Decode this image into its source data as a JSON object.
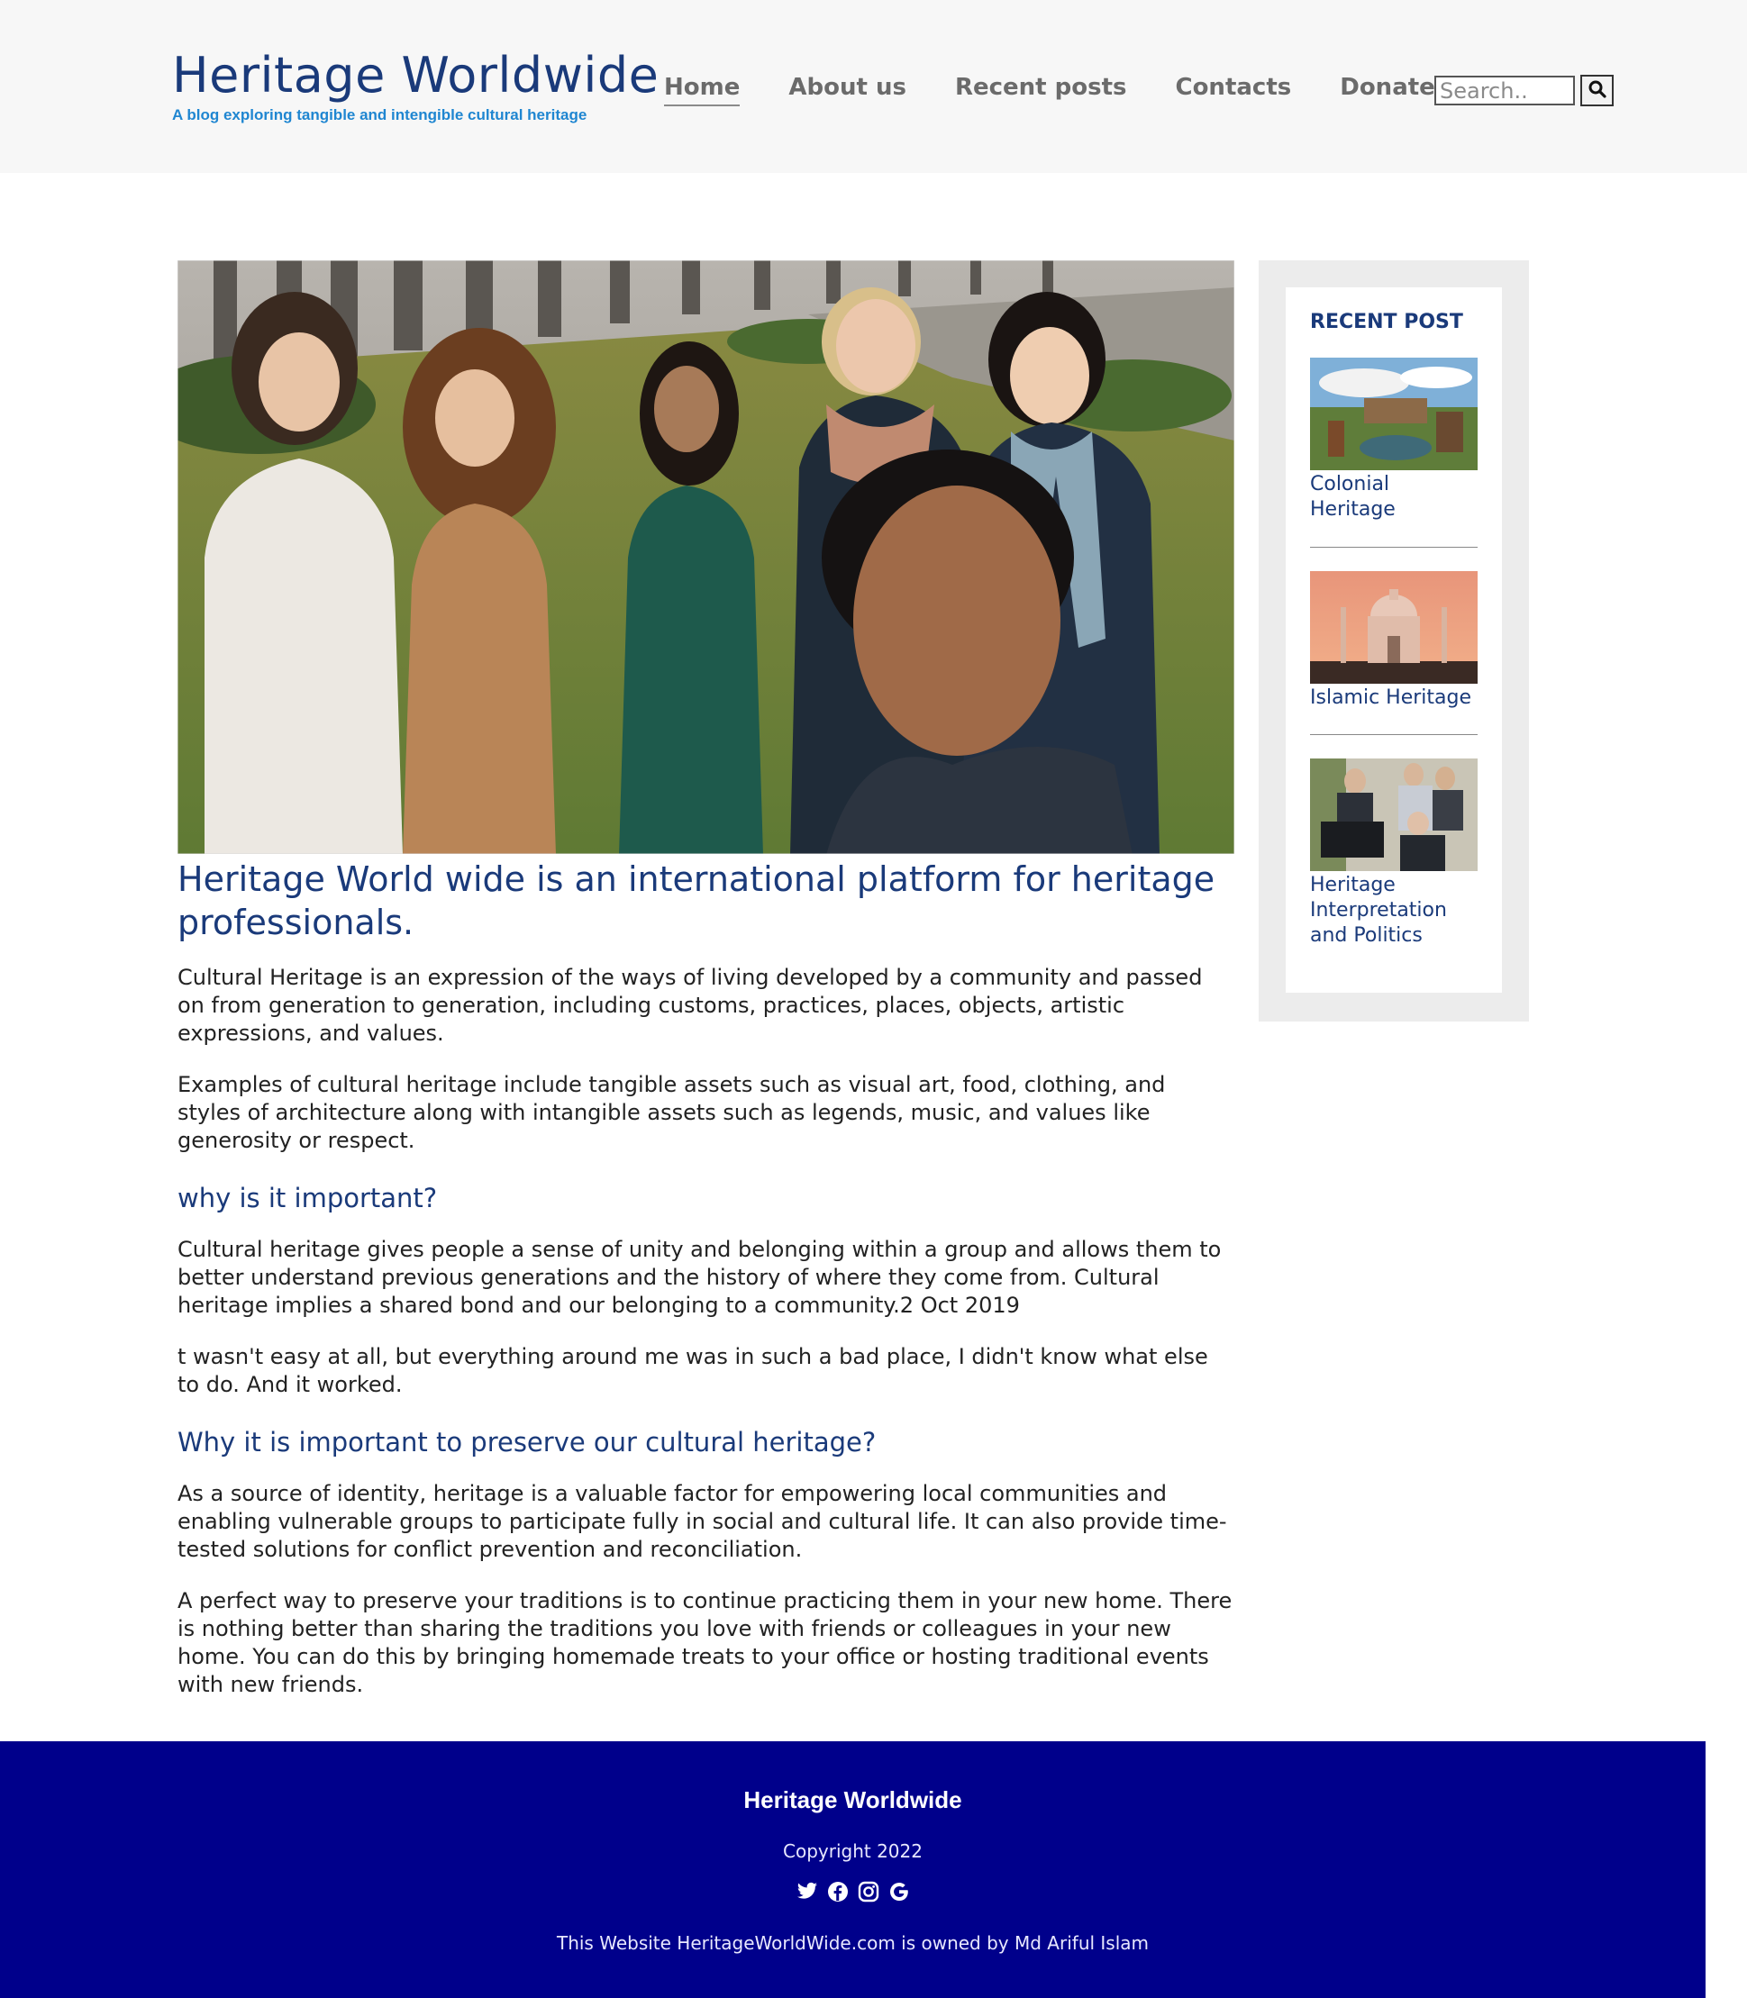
{
  "header": {
    "title": "Heritage Worldwide",
    "tagline": "A blog exploring tangible and intengible cultural heritage",
    "nav": [
      {
        "label": "Home"
      },
      {
        "label": "About us"
      },
      {
        "label": "Recent posts"
      },
      {
        "label": "Contacts"
      },
      {
        "label": "Donates"
      }
    ],
    "search": {
      "placeholder": "Search..",
      "button_icon": "search-icon"
    }
  },
  "main": {
    "headline": "Heritage World wide is an international platform for heritage professionals.",
    "paragraphs_intro": [
      "Cultural Heritage is an expression of the ways of living developed by a community and passed on from generation to generation, including customs, practices, places, objects, artistic expressions, and values.",
      "Examples of cultural heritage include tangible assets such as visual art, food, clothing, and styles of architecture along with intangible assets such as legends, music, and values like generosity or respect."
    ],
    "heading_important": "why is it important?",
    "paragraphs_important": [
      "Cultural heritage gives people a sense of unity and belonging within a group and allows them to better understand previous generations and the history of where they come from. Cultural heritage implies a shared bond and our belonging to a community.2 Oct 2019",
      "t wasn't easy at all, but everything around me was in such a bad place, I didn't know what else to do. And it worked."
    ],
    "heading_preserve": "Why it is important to preserve our cultural heritage?",
    "paragraphs_preserve": [
      "As a source of identity, heritage is a valuable factor for empowering local communities and enabling vulnerable groups to participate fully in social and cultural life. It can also provide time-tested solutions for conflict prevention and reconciliation.",
      "A perfect way to preserve your traditions is to continue practicing them in your new home. There is nothing better than sharing the traditions you love with friends or colleagues in your new home. You can do this by bringing homemade treats to your office or hosting traditional events with new friends."
    ]
  },
  "sidebar": {
    "title": "RECENT POST",
    "posts": [
      {
        "label": "Colonial Heritage"
      },
      {
        "label": "Islamic Heritage"
      },
      {
        "label": "Heritage Interpretation and Politics"
      }
    ]
  },
  "footer": {
    "title": "Heritage Worldwide",
    "copyright": "Copyright 2022",
    "social": [
      "twitter-icon",
      "facebook-icon",
      "instagram-icon",
      "google-icon"
    ],
    "owner": "This Website HeritageWorldWide.com is owned by Md Ariful Islam"
  },
  "colors": {
    "brand": "#1a3a7a",
    "tagline": "#1f86d1",
    "footer_bg": "#00008b",
    "header_bg": "#f7f7f7"
  }
}
